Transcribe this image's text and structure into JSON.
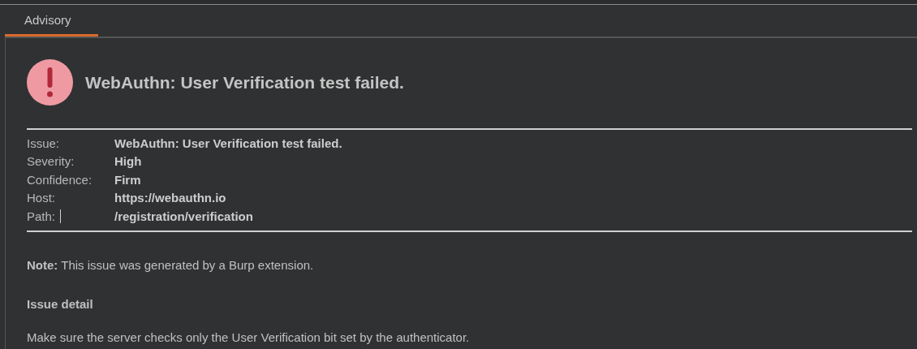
{
  "tabs": [
    {
      "label": "Advisory",
      "selected": true
    }
  ],
  "advisory": {
    "title": "WebAuthn: User Verification test failed.",
    "fields": [
      {
        "label": "Issue:",
        "value": "WebAuthn: User Verification test failed."
      },
      {
        "label": "Severity:",
        "value": "High"
      },
      {
        "label": "Confidence:",
        "value": "Firm"
      },
      {
        "label": "Host:",
        "value": "https://webauthn.io"
      },
      {
        "label": "Path:",
        "value": "/registration/verification"
      }
    ],
    "note": "**Note:** This issue was generated by a Burp extension.",
    "detail_heading": "Issue detail",
    "detail": "Make sure the server checks only the User Verification bit set by the authenticator."
  }
}
